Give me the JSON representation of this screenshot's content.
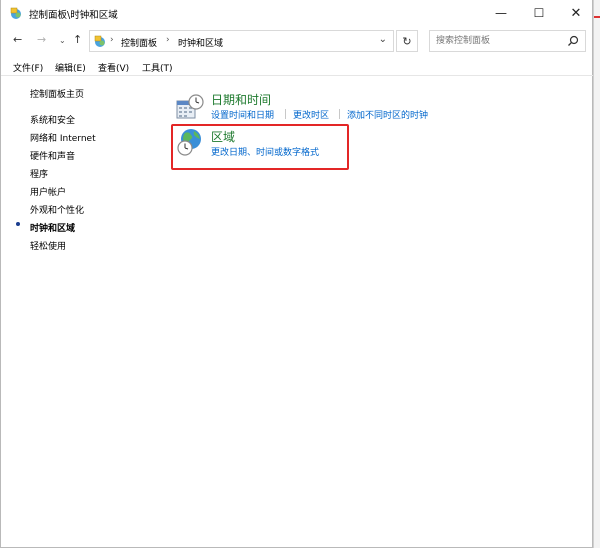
{
  "window": {
    "title": "控制面板\\时钟和区域",
    "controls": {
      "minimize": "—",
      "maximize": "☐",
      "close": "✕"
    }
  },
  "nav": {
    "back": "←",
    "forward": "→",
    "recent": "⌄",
    "up": "↑",
    "breadcrumb": [
      "控制面板",
      "时钟和区域"
    ],
    "crumb_separator": "›",
    "dropdown": "⌄",
    "refresh": "↻",
    "search_placeholder": "搜索控制面板"
  },
  "menu": {
    "items": [
      "文件(F)",
      "编辑(E)",
      "查看(V)",
      "工具(T)"
    ]
  },
  "sidebar": {
    "home": "控制面板主页",
    "items": [
      {
        "label": "系统和安全"
      },
      {
        "label": "网络和 Internet"
      },
      {
        "label": "硬件和声音"
      },
      {
        "label": "程序"
      },
      {
        "label": "用户帐户"
      },
      {
        "label": "外观和个性化"
      },
      {
        "label": "时钟和区域",
        "active": true
      },
      {
        "label": "轻松使用"
      }
    ]
  },
  "categories": [
    {
      "icon": "date-time-icon",
      "title": "日期和时间",
      "links": [
        "设置时间和日期",
        "更改时区",
        "添加不同时区的时钟"
      ]
    },
    {
      "icon": "region-globe-icon",
      "title": "区域",
      "links": [
        "更改日期、时间或数字格式"
      ]
    }
  ],
  "colors": {
    "category_title": "#1e7a2e",
    "link": "#0066cc",
    "highlight_border": "#e32626"
  }
}
